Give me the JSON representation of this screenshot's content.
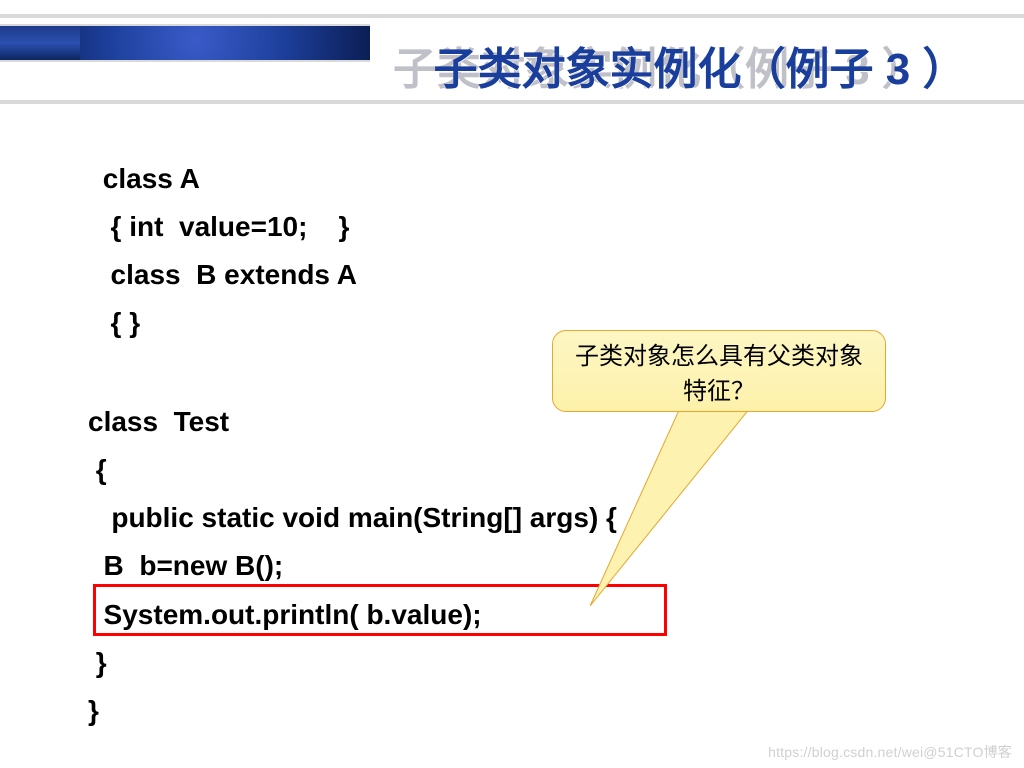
{
  "title": "子类对象实例化（例子 3 ）",
  "code_block1": " class A\n  { int  value=10;    }\n  class  B extends A\n  { }",
  "code_block2": "class  Test\n {\n   public static void main(String[] args) {\n  B  b=new B();\n  System.out.println( b.value);\n }\n}",
  "callout_line1": "子类对象怎么具有父类对象",
  "callout_line2": "特征？",
  "watermark": "https://blog.csdn.net/wei@51CTO博客"
}
